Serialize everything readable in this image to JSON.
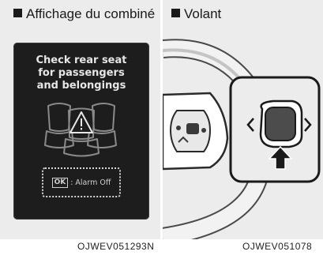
{
  "left_panel": {
    "caption": "Affichage du combiné",
    "message": "Check rear seat\nfor passengers\nand belongings",
    "ok_label": "OK",
    "alarm_label": ": Alarm Off",
    "figure_code": "OJWEV051293N"
  },
  "right_panel": {
    "caption": "Volant",
    "figure_code": "OJWEV051078"
  },
  "colors": {
    "panel_bg": "#ececec",
    "screen_bg": "#1d1d1d",
    "screen_text": "#e6e6e6"
  },
  "icons": [
    "warning-triangle-icon",
    "rear-seat-icon",
    "ok-button-icon",
    "arrow-up-icon",
    "chevron-left-icon",
    "chevron-right-icon"
  ]
}
